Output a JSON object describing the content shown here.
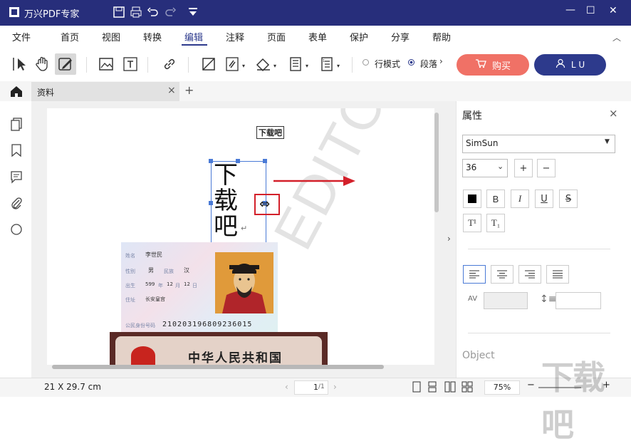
{
  "app": {
    "title": "万兴PDF专家"
  },
  "window_controls": {
    "minimize": "—",
    "maximize": "☐",
    "close": "✕"
  },
  "menu": {
    "items": [
      "文件",
      "首页",
      "视图",
      "转换",
      "编辑",
      "注释",
      "页面",
      "表单",
      "保护",
      "分享",
      "帮助"
    ],
    "active_index": 4
  },
  "toolbar": {
    "mode_line": "行模式",
    "mode_paragraph": "段落",
    "buy_label": "购买",
    "user_label": "L U",
    "buy_color": "#f07166",
    "user_color": "#2d3a8c"
  },
  "tabs": {
    "active": "资料",
    "close": "×",
    "add": "+"
  },
  "document": {
    "small_label": "下载吧",
    "big_text": "下\n载\n吧",
    "watermark": "EDITOR",
    "id_card": {
      "name_label": "姓名",
      "name": "李世民",
      "sex_label": "性别",
      "sex": "男",
      "ethnic_label": "民族",
      "ethnic": "汉",
      "birth_label": "出生",
      "year": "599",
      "y": "年",
      "month": "12",
      "m": "月",
      "day": "12",
      "d": "日",
      "addr_label": "住址",
      "addr": "长安皇宫",
      "number_label": "公民身份号码",
      "number": "210203196809236015"
    },
    "cover_title": "中华人民共和国"
  },
  "properties": {
    "title": "属性",
    "close": "×",
    "font": "SimSun",
    "size": "36",
    "plus": "+",
    "minus": "−",
    "bold": "B",
    "italic": "I",
    "underline": "U",
    "strike": "S",
    "sup": "T¹",
    "sub": "T₁",
    "object_label": "Object"
  },
  "status": {
    "page_size": "21 X 29.7 cm",
    "page_current": "1",
    "page_total": "/1",
    "zoom": "75%"
  },
  "watermark_corner": "下载吧"
}
